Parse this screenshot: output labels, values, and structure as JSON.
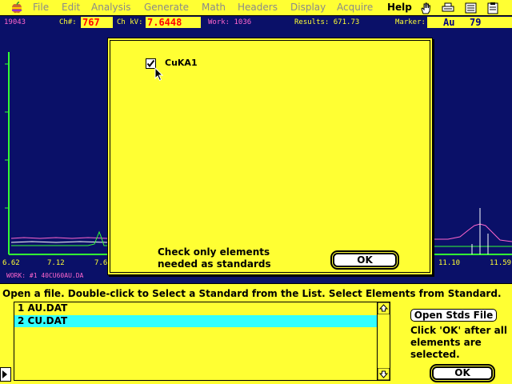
{
  "menubar": {
    "items": [
      "File",
      "Edit",
      "Analysis",
      "Generate",
      "Math",
      "Headers",
      "Display",
      "Acquire",
      "Help"
    ],
    "active": "Help",
    "icons": [
      "apple-logo",
      "hand-icon",
      "printer-icon",
      "list-icon",
      "clipboard-icon"
    ]
  },
  "spectrum": {
    "counts": "19043",
    "ch_label": "Ch#:",
    "ch_value": "767",
    "kv_label": "Ch kV:",
    "kv_value": "7.6448",
    "work_label": "Work: 1036",
    "results_label": "Results: 671.73",
    "marker_label": "Marker:",
    "marker_element": "Au",
    "marker_number": "79",
    "x_ticks": [
      "6.62",
      "7.12",
      "7.6",
      "11.10",
      "11.59"
    ],
    "work_file": "WORK: #1  40CU60AU.DA",
    "colors": {
      "background": "#0a1068",
      "axis": "#33ff33",
      "trace_pink": "#ff66cc",
      "marker": "#ffffff"
    }
  },
  "dialog": {
    "checkbox_label": "CuKA1",
    "checkbox_checked": true,
    "message_line1": "Check only elements",
    "message_line2": "needed as standards",
    "ok_label": "OK"
  },
  "bottom": {
    "instruction": "Open a file. Double-click to Select a Standard from the List. Select Elements from Standard.",
    "list_items": [
      {
        "label": "1  AU.DAT",
        "selected": false
      },
      {
        "label": "2  CU.DAT",
        "selected": true
      }
    ],
    "open_stds_label": "Open Stds File",
    "hint_line1": "Click 'OK' after all",
    "hint_line2": "elements are",
    "hint_line3": "selected.",
    "ok_label": "OK"
  },
  "colors": {
    "panel": "#ffff33",
    "selection": "#33ffff"
  }
}
